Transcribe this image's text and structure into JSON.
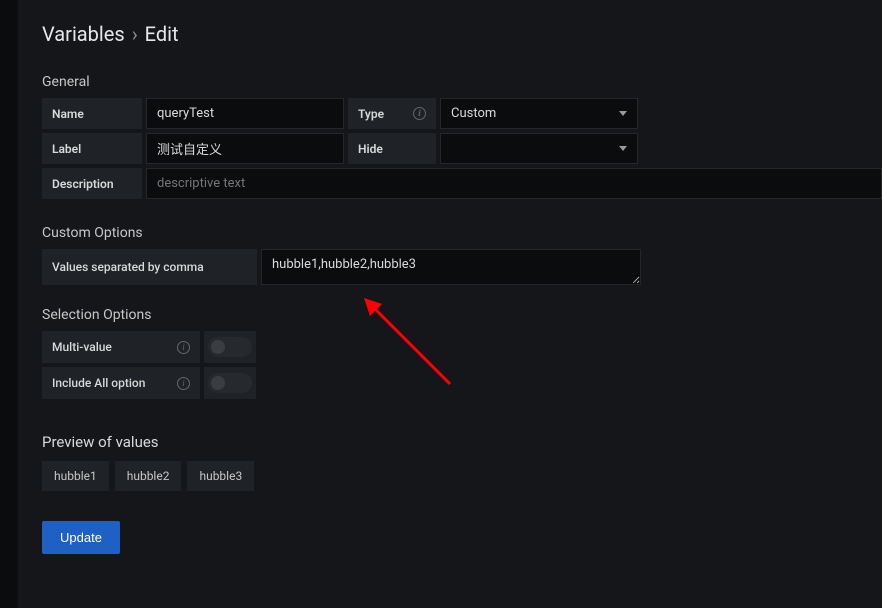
{
  "header": {
    "breadcrumb_root": "Variables",
    "breadcrumb_separator": "›",
    "breadcrumb_leaf": "Edit"
  },
  "general": {
    "section_title": "General",
    "name_label": "Name",
    "name_value": "queryTest",
    "type_label": "Type",
    "type_value": "Custom",
    "label_label": "Label",
    "label_value": "测试自定义",
    "hide_label": "Hide",
    "hide_value": "",
    "description_label": "Description",
    "description_placeholder": "descriptive text",
    "description_value": ""
  },
  "custom_options": {
    "section_title": "Custom Options",
    "values_label": "Values separated by comma",
    "values_value": "hubble1,hubble2,hubble3"
  },
  "selection_options": {
    "section_title": "Selection Options",
    "multi_value_label": "Multi-value",
    "include_all_label": "Include All option"
  },
  "preview": {
    "section_title": "Preview of values",
    "values": [
      "hubble1",
      "hubble2",
      "hubble3"
    ]
  },
  "actions": {
    "update_label": "Update"
  }
}
